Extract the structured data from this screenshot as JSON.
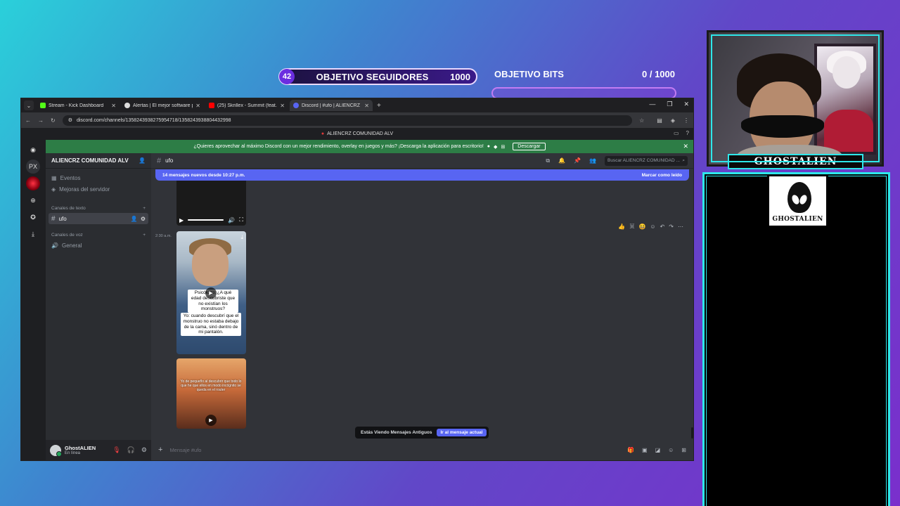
{
  "overlay": {
    "followers_goal": {
      "current": "42",
      "label": "OBJETIVO SEGUIDORES",
      "target": "1000"
    },
    "bits_goal": {
      "label": "OBJETIVO BITS",
      "value": "0 / 1000",
      "progress": 0
    },
    "webcam_name": "GHOSTALIEN",
    "chat_logo_text": "GHOSTALIEN",
    "accent_color": "#2ee7ea"
  },
  "browser": {
    "tabs": [
      {
        "title": "Stream - Kick Dashboard",
        "icon_color": "#53fc18"
      },
      {
        "title": "Alertas | El mejor software para",
        "icon_color": "#dddddd"
      },
      {
        "title": "(25) Skrillex - Summit (feat. Elli",
        "icon_color": "#ff0000"
      },
      {
        "title": "Discord | #ufo | ALIENCRZ CO",
        "icon_color": "#5865f2"
      }
    ],
    "url": "discord.com/channels/1358243938275954718/1358243938804432998"
  },
  "discord": {
    "window_title": "ALIENCRZ COMUNIDAD ALV",
    "promo_text": "¿Quieres aprovechar al máximo Discord con un mejor rendimiento, overlay en juegos y más? ¡Descarga la aplicación para escritorio!",
    "promo_button": "Descargar",
    "server_name": "ALIENCRZ COMUNIDAD ALV",
    "events": "Eventos",
    "boosts": "Mejoras del servidor",
    "text_category": "Canales de texto",
    "active_channel": "ufo",
    "voice_category": "Canales de voz",
    "voice_channel": "General",
    "rail_px": "PX",
    "user": {
      "name": "GhostALIEN",
      "status": "En línea"
    },
    "channel_header": "ufo",
    "search_placeholder": "Buscar ALIENCRZ COMUNIDAD ...",
    "new_messages": "14 mensajes nuevos desde 10:27 p.m.",
    "mark_read": "Marcar como leído",
    "timestamp": "2:30 a.m.",
    "caption_1": "Psicólogo: ¿A qué edad descubriste que no existían los monstruos?",
    "caption_2": "Yo: cuando descubrí que el monstruo no estaba debajo de la cama, sinó dentro de mi pantalón.",
    "caption_3": "Yo de pequeño al descubrir que todo lo que he que ellos en modo incógnito se queda en el router",
    "old_messages": "Estás Viendo Mensajes Antiguos",
    "jump_button": "Ir al mensaje actual",
    "composer_placeholder": "Mensaje #ufo"
  }
}
